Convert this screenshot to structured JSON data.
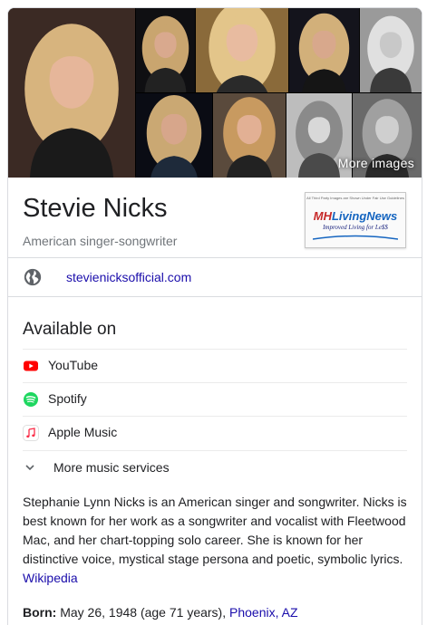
{
  "images": {
    "more_label": "More images",
    "tiles": [
      {
        "name": "main-photo",
        "bg": "#3b2a24",
        "hair": "#d7b47e",
        "skin": "#e6b69a",
        "cloth": "#1a1a1a"
      },
      {
        "name": "photo-stage-1",
        "bg": "#0f0f12",
        "hair": "#c9a56f",
        "skin": "#d9a98e",
        "cloth": "#222"
      },
      {
        "name": "photo-closeup-1",
        "bg": "#8a6a3a",
        "hair": "#e3c58a",
        "skin": "#e8bba0",
        "cloth": "#2a2a2a"
      },
      {
        "name": "photo-stage-2",
        "bg": "#14141c",
        "hair": "#d2b07a",
        "skin": "#d8a88c",
        "cloth": "#151515"
      },
      {
        "name": "photo-bw-1",
        "bg": "#9a9a9a",
        "hair": "#e0e0e0",
        "skin": "#c8c8c8",
        "cloth": "#3a3a3a"
      },
      {
        "name": "photo-stage-3",
        "bg": "#0a0c14",
        "hair": "#caa873",
        "skin": "#d7a68b",
        "cloth": "#1e2a3a"
      },
      {
        "name": "photo-portrait-1",
        "bg": "#5a4a3c",
        "hair": "#c89a60",
        "skin": "#e2b094",
        "cloth": "#222"
      },
      {
        "name": "photo-bw-2",
        "bg": "#bdbdbd",
        "hair": "#8a8a8a",
        "skin": "#d8d8d8",
        "cloth": "#4a4a4a"
      },
      {
        "name": "photo-bw-3",
        "bg": "#6a6a6a",
        "hair": "#a0a0a0",
        "skin": "#cfcfcf",
        "cloth": "#2a2a2a"
      }
    ]
  },
  "header": {
    "title": "Stevie Nicks",
    "subtitle": "American singer-songwriter"
  },
  "ad": {
    "top_text": "All Third Party Images are Shown Under Fair Use Guidelines",
    "logo_mh": "MH",
    "logo_rest": "LivingNews",
    "tagline": "Improved Living for Le$$"
  },
  "website": {
    "icon": "globe-icon",
    "link": "stevienicksofficial.com"
  },
  "available_on": {
    "title": "Available on",
    "services": [
      {
        "label": "YouTube",
        "icon": "youtube-icon",
        "color": "#ff0000"
      },
      {
        "label": "Spotify",
        "icon": "spotify-icon",
        "color": "#1ed760"
      },
      {
        "label": "Apple Music",
        "icon": "apple-music-icon",
        "color": "#fa2d48"
      }
    ],
    "more_label": "More music services"
  },
  "description": {
    "text": "Stephanie Lynn Nicks is an American singer and songwriter. Nicks is best known for her work as a songwriter and vocalist with Fleetwood Mac, and her chart-topping solo career. She is known for her distinctive voice, mystical stage persona and poetic, symbolic lyrics.",
    "source": "Wikipedia"
  },
  "born": {
    "label": "Born:",
    "value": "May 26, 1948 (age 71 years),",
    "place": "Phoenix, AZ"
  }
}
